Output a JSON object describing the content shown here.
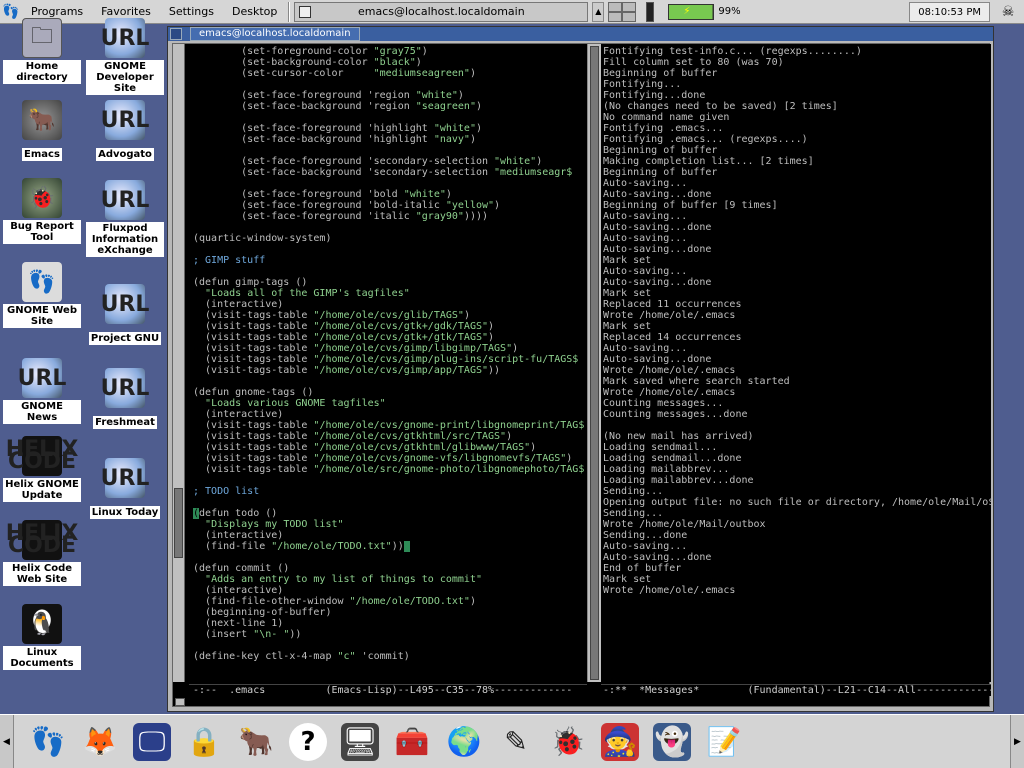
{
  "top_panel": {
    "menus": [
      "Programs",
      "Favorites",
      "Settings",
      "Desktop"
    ],
    "task_title": "emacs@localhost.localdomain",
    "battery_percent": "99%",
    "battery_level": 0.99,
    "clock": "08:10:53 PM",
    "icons": [
      "gnome-foot-icon",
      "tasklist-arrow-icon",
      "pager-icon",
      "thermometer-icon",
      "battery-icon",
      "foot-menu-icon"
    ]
  },
  "desktop_icons": [
    {
      "label": "Home directory",
      "icon": "folder-icon"
    },
    {
      "label": "GNOME Developer Site",
      "icon": "url-icon"
    },
    {
      "label": "Emacs",
      "icon": "gnu-icon"
    },
    {
      "label": "Advogato",
      "icon": "url-icon"
    },
    {
      "label": "Bug Report Tool",
      "icon": "bug-icon"
    },
    {
      "label": "Fluxpod Information eXchange",
      "icon": "url-icon"
    },
    {
      "label": "GNOME Web Site",
      "icon": "gnome-foot-icon"
    },
    {
      "label": "Project GNU",
      "icon": "url-icon"
    },
    {
      "label": "GNOME News",
      "icon": "url-icon"
    },
    {
      "label": "Freshmeat",
      "icon": "url-icon"
    },
    {
      "label": "Helix GNOME Update",
      "icon": "helix-icon"
    },
    {
      "label": "Linux Today",
      "icon": "url-icon"
    },
    {
      "label": "Helix Code Web Site",
      "icon": "helix-icon"
    },
    {
      "label": "Linux Documents",
      "icon": "penguin-icon"
    }
  ],
  "helix_logo": {
    "line1": "HELIX",
    "line2": "CODE"
  },
  "url_badge": "URL",
  "emacs": {
    "title_tab": "emacs@localhost.localdomain",
    "left_lines": [
      "        (set-foreground-color \"gray75\")",
      "        (set-background-color \"black\")",
      "        (set-cursor-color     \"mediumseagreen\")",
      "",
      "        (set-face-foreground 'region \"white\")",
      "        (set-face-background 'region \"seagreen\")",
      "",
      "        (set-face-foreground 'highlight \"white\")",
      "        (set-face-background 'highlight \"navy\")",
      "",
      "        (set-face-foreground 'secondary-selection \"white\")",
      "        (set-face-background 'secondary-selection \"mediumseagr$",
      "",
      "        (set-face-foreground 'bold \"white\")",
      "        (set-face-foreground 'bold-italic \"yellow\")",
      "        (set-face-foreground 'italic \"gray90\"))))",
      "",
      "(quartic-window-system)",
      "",
      "; GIMP stuff",
      "",
      "(defun gimp-tags ()",
      "  \"Loads all of the GIMP's tagfiles\"",
      "  (interactive)",
      "  (visit-tags-table \"/home/ole/cvs/glib/TAGS\")",
      "  (visit-tags-table \"/home/ole/cvs/gtk+/gdk/TAGS\")",
      "  (visit-tags-table \"/home/ole/cvs/gtk+/gtk/TAGS\")",
      "  (visit-tags-table \"/home/ole/cvs/gimp/libgimp/TAGS\")",
      "  (visit-tags-table \"/home/ole/cvs/gimp/plug-ins/script-fu/TAGS$",
      "  (visit-tags-table \"/home/ole/cvs/gimp/app/TAGS\"))",
      "",
      "(defun gnome-tags ()",
      "  \"Loads various GNOME tagfiles\"",
      "  (interactive)",
      "  (visit-tags-table \"/home/ole/cvs/gnome-print/libgnomeprint/TAG$",
      "  (visit-tags-table \"/home/ole/cvs/gtkhtml/src/TAGS\")",
      "  (visit-tags-table \"/home/ole/cvs/gtkhtml/glibwww/TAGS\")",
      "  (visit-tags-table \"/home/ole/cvs/gnome-vfs/libgnomevfs/TAGS\")",
      "  (visit-tags-table \"/home/ole/src/gnome-photo/libgnomephoto/TAG$",
      "",
      "; TODO list",
      "",
      "(defun todo ()",
      "  \"Displays my TODO list\"",
      "  (interactive)",
      "  (find-file \"/home/ole/TODO.txt\"))",
      "",
      "(defun commit ()",
      "  \"Adds an entry to my list of things to commit\"",
      "  (interactive)",
      "  (find-file-other-window \"/home/ole/TODO.txt\")",
      "  (beginning-of-buffer)",
      "  (next-line 1)",
      "  (insert \"\\n- \"))",
      "",
      "(define-key ctl-x-4-map \"c\" 'commit)"
    ],
    "right_lines": [
      "Fontifying test-info.c... (regexps........)",
      "Fill column set to 80 (was 70)",
      "Beginning of buffer",
      "Fontifying...",
      "Fontifying...done",
      "(No changes need to be saved) [2 times]",
      "No command name given",
      "Fontifying .emacs...",
      "Fontifying .emacs... (regexps....)",
      "Beginning of buffer",
      "Making completion list... [2 times]",
      "Beginning of buffer",
      "Auto-saving...",
      "Auto-saving...done",
      "Beginning of buffer [9 times]",
      "Auto-saving...",
      "Auto-saving...done",
      "Auto-saving...",
      "Auto-saving...done",
      "Mark set",
      "Auto-saving...",
      "Auto-saving...done",
      "Mark set",
      "Replaced 11 occurrences",
      "Wrote /home/ole/.emacs",
      "Mark set",
      "Replaced 14 occurrences",
      "Auto-saving...",
      "Auto-saving...done",
      "Wrote /home/ole/.emacs",
      "Mark saved where search started",
      "Wrote /home/ole/.emacs",
      "Counting messages...",
      "Counting messages...done",
      "",
      "(No new mail has arrived)",
      "Loading sendmail...",
      "Loading sendmail...done",
      "Loading mailabbrev...",
      "Loading mailabbrev...done",
      "Sending...",
      "Opening output file: no such file or directory, /home/ole/Mail/o$",
      "Sending...",
      "Wrote /home/ole/Mail/outbox",
      "Sending...done",
      "Auto-saving...",
      "Auto-saving...done",
      "End of buffer",
      "Mark set",
      "Wrote /home/ole/.emacs"
    ],
    "modeline_left": "-:--  .emacs          (Emacs-Lisp)--L495--C35--78%-------------",
    "modeline_right": "-:**  *Messages*        (Fundamental)--L21--C14--All-------------",
    "left_scroll_position": 0.78,
    "right_scroll_position": 1.0
  },
  "bottom_panel": {
    "launchers": [
      "gnome-foot-icon",
      "gimp-icon",
      "monitor-icon",
      "padlock-icon",
      "gnu-icon",
      "help-icon",
      "terminal-icon",
      "toolbox-icon",
      "globe-icon",
      "drawing-icon",
      "bug-icon",
      "wizard-icon",
      "ghost-icon",
      "editor-icon"
    ]
  },
  "colors": {
    "desktop": "#4f5d8f",
    "string": "#8fd18f",
    "comment": "#6fa8dc",
    "cursor": "#2e8b57",
    "text": "#bfbfbf",
    "titlebar": "#3a5fa0"
  }
}
